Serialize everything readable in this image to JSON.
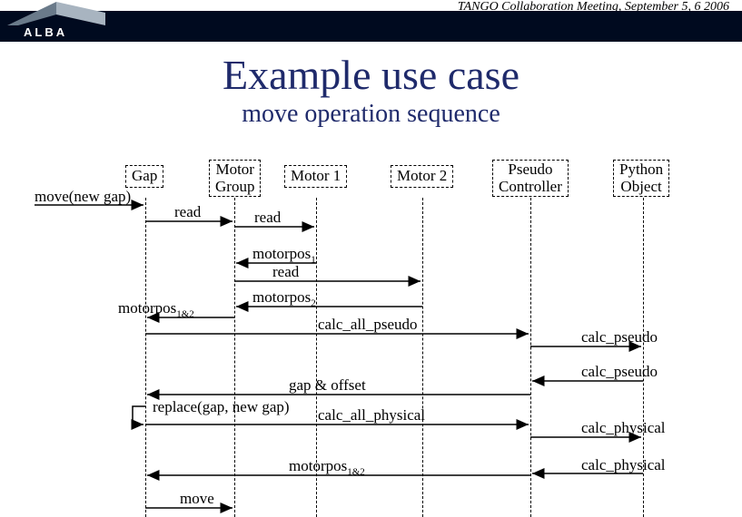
{
  "meeting": "TANGO Collaboration Meeting, September 5, 6 2006",
  "logo_text": "ALBA",
  "title": "Example use case",
  "subtitle": "move operation sequence",
  "lifelines": {
    "gap": "Gap",
    "motor_group": "Motor\nGroup",
    "motor1": "Motor 1",
    "motor2": "Motor 2",
    "pseudo_ctrl": "Pseudo\nController",
    "python_obj": "Python\nObject"
  },
  "messages": {
    "move_new_gap": "move(new gap)",
    "read1": "read",
    "read2": "read",
    "motorpos1": "motorpos",
    "motorpos1_sub": "1",
    "read3": "read",
    "motorpos2": "motorpos",
    "motorpos2_sub": "2",
    "motorpos12_left": "motorpos",
    "motorpos12_left_sub": "1&2",
    "calc_all_pseudo": "calc_all_pseudo",
    "calc_pseudo1": "calc_pseudo",
    "calc_pseudo2": "calc_pseudo",
    "gap_offset": "gap & offset",
    "replace": "replace(gap, new gap)",
    "calc_all_physical": "calc_all_physical",
    "calc_physical1": "calc_physical",
    "calc_physical2": "calc_physical",
    "motorpos12_right": "motorpos",
    "motorpos12_right_sub": "1&2",
    "move": "move"
  },
  "chart_data": {
    "type": "sequence-diagram",
    "title": "Example use case — move operation sequence",
    "lifelines": [
      "Gap",
      "Motor Group",
      "Motor 1",
      "Motor 2",
      "Pseudo Controller",
      "Python Object"
    ],
    "messages": [
      {
        "from": "(caller)",
        "to": "Gap",
        "label": "move(new gap)"
      },
      {
        "from": "Gap",
        "to": "Motor Group",
        "label": "read"
      },
      {
        "from": "Motor Group",
        "to": "Motor 1",
        "label": "read"
      },
      {
        "from": "Motor 1",
        "to": "Motor Group",
        "label": "motorpos1",
        "return": true
      },
      {
        "from": "Motor Group",
        "to": "Motor 2",
        "label": "read"
      },
      {
        "from": "Motor 2",
        "to": "Motor Group",
        "label": "motorpos2",
        "return": true
      },
      {
        "from": "Motor Group",
        "to": "Gap",
        "label": "motorpos1&2",
        "return": true
      },
      {
        "from": "Gap",
        "to": "Pseudo Controller",
        "label": "calc_all_pseudo"
      },
      {
        "from": "Pseudo Controller",
        "to": "Python Object",
        "label": "calc_pseudo"
      },
      {
        "from": "Python Object",
        "to": "Pseudo Controller",
        "label": "calc_pseudo",
        "return": true
      },
      {
        "from": "Pseudo Controller",
        "to": "Gap",
        "label": "gap & offset",
        "return": true
      },
      {
        "from": "Gap",
        "to": "Gap",
        "label": "replace(gap, new gap)",
        "self": true
      },
      {
        "from": "Gap",
        "to": "Pseudo Controller",
        "label": "calc_all_physical"
      },
      {
        "from": "Pseudo Controller",
        "to": "Python Object",
        "label": "calc_physical"
      },
      {
        "from": "Python Object",
        "to": "Pseudo Controller",
        "label": "calc_physical",
        "return": true
      },
      {
        "from": "Pseudo Controller",
        "to": "Gap",
        "label": "motorpos1&2",
        "return": true
      },
      {
        "from": "Gap",
        "to": "Motor Group",
        "label": "move"
      }
    ]
  }
}
